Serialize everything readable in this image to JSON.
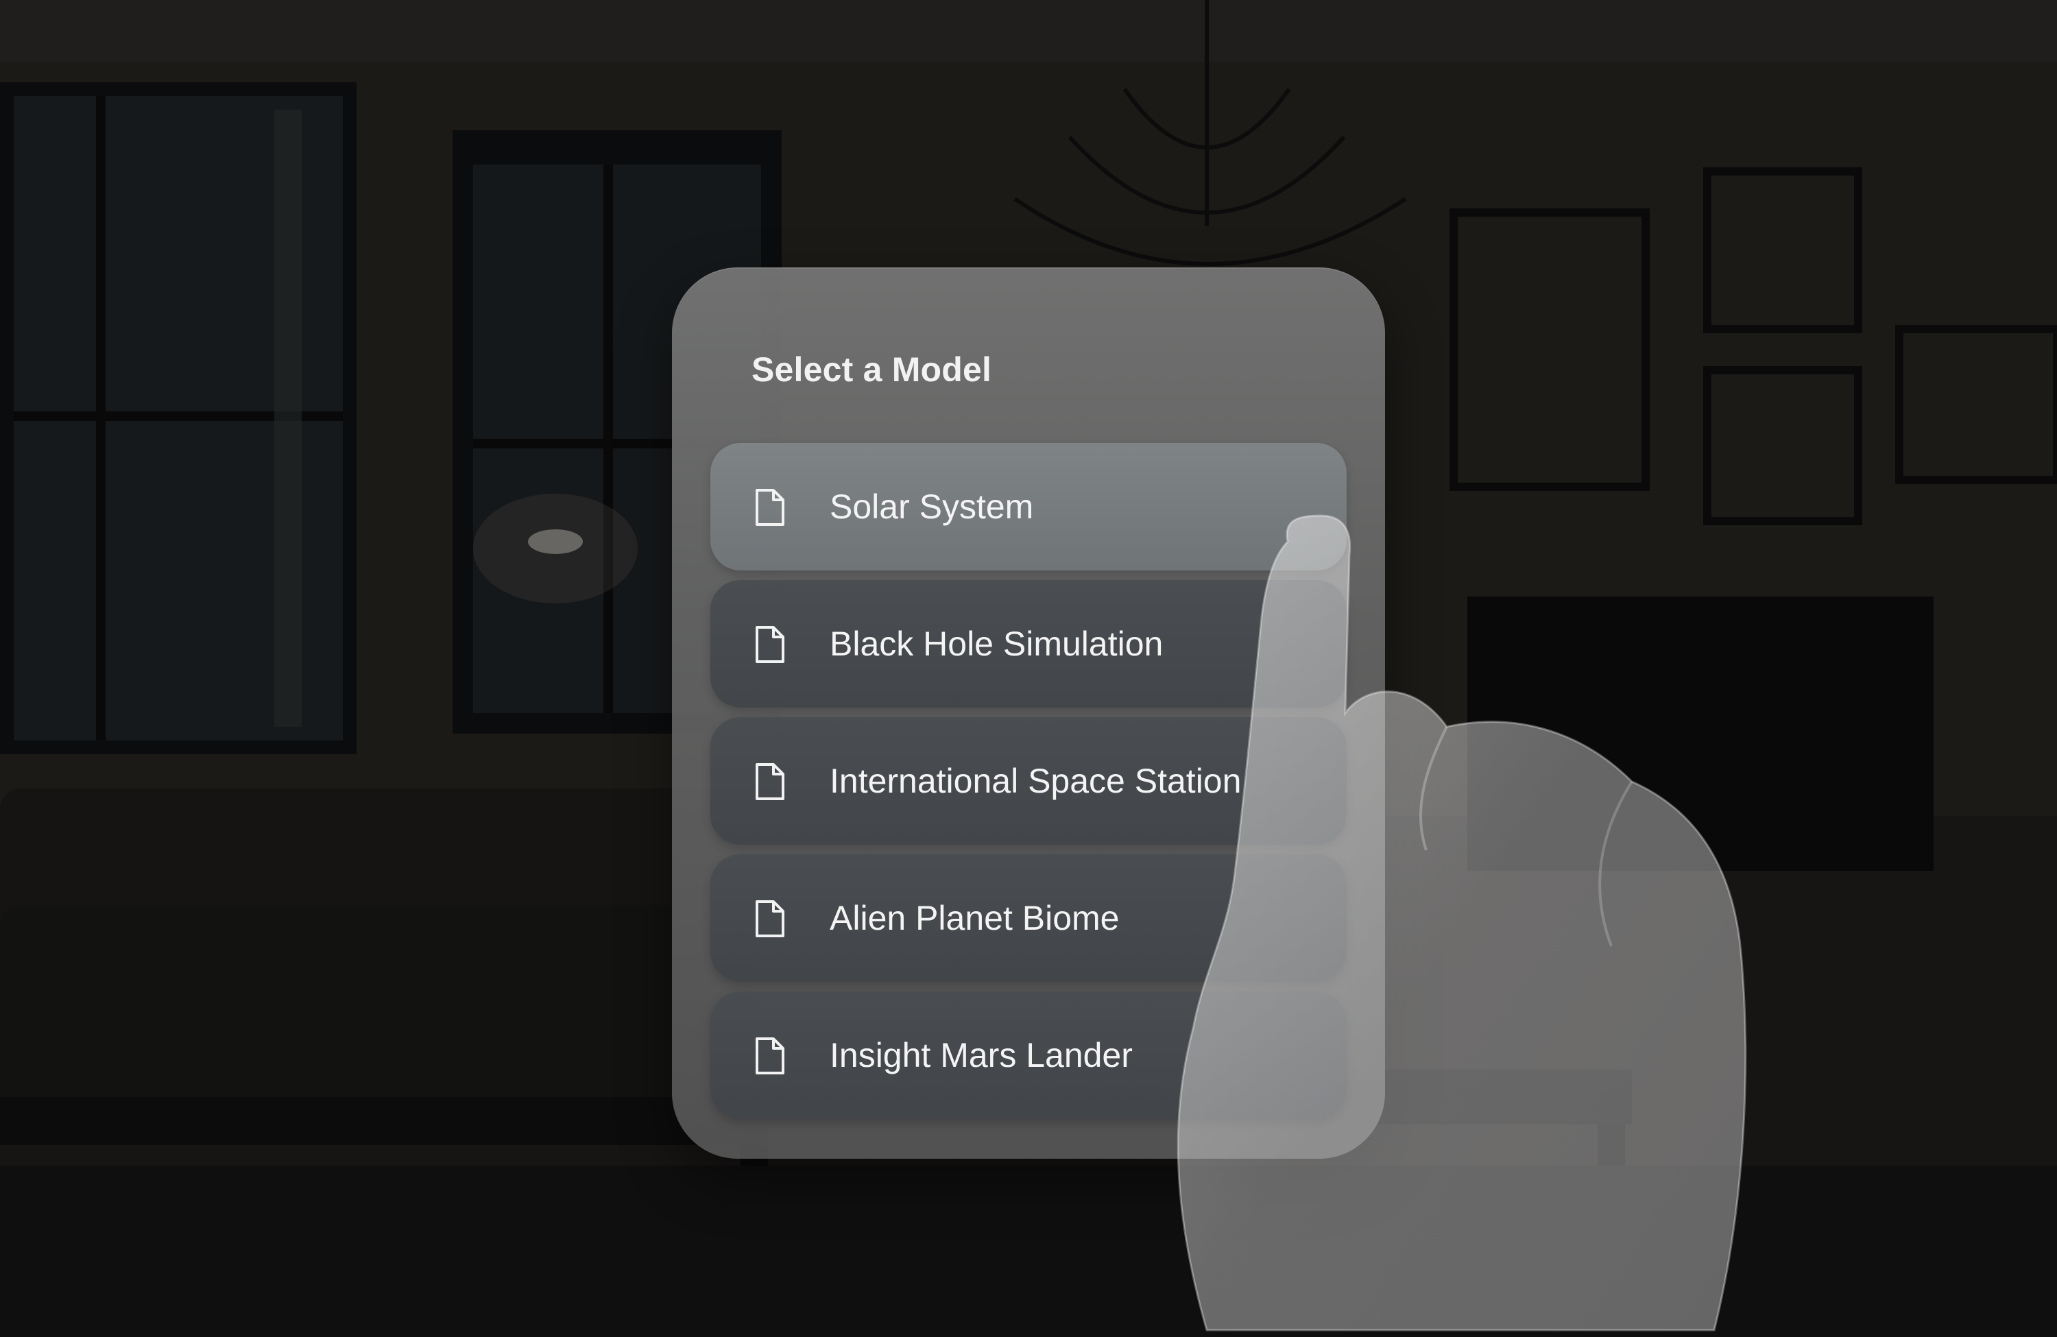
{
  "panel": {
    "title": "Select a Model"
  },
  "models": [
    {
      "label": "Solar System",
      "icon": "file-icon",
      "state": "highlighted"
    },
    {
      "label": "Black Hole Simulation",
      "icon": "file-icon",
      "state": "normal"
    },
    {
      "label": "International Space Station",
      "icon": "file-icon",
      "state": "normal"
    },
    {
      "label": "Alien Planet Biome",
      "icon": "file-icon",
      "state": "normal"
    },
    {
      "label": "Insight Mars Lander",
      "icon": "file-icon",
      "state": "normal"
    }
  ],
  "colors": {
    "panel": "#6c6c6c",
    "item_highlight": "#7e8386",
    "item_normal": "#464a4e",
    "text": "#f4f4f4"
  }
}
